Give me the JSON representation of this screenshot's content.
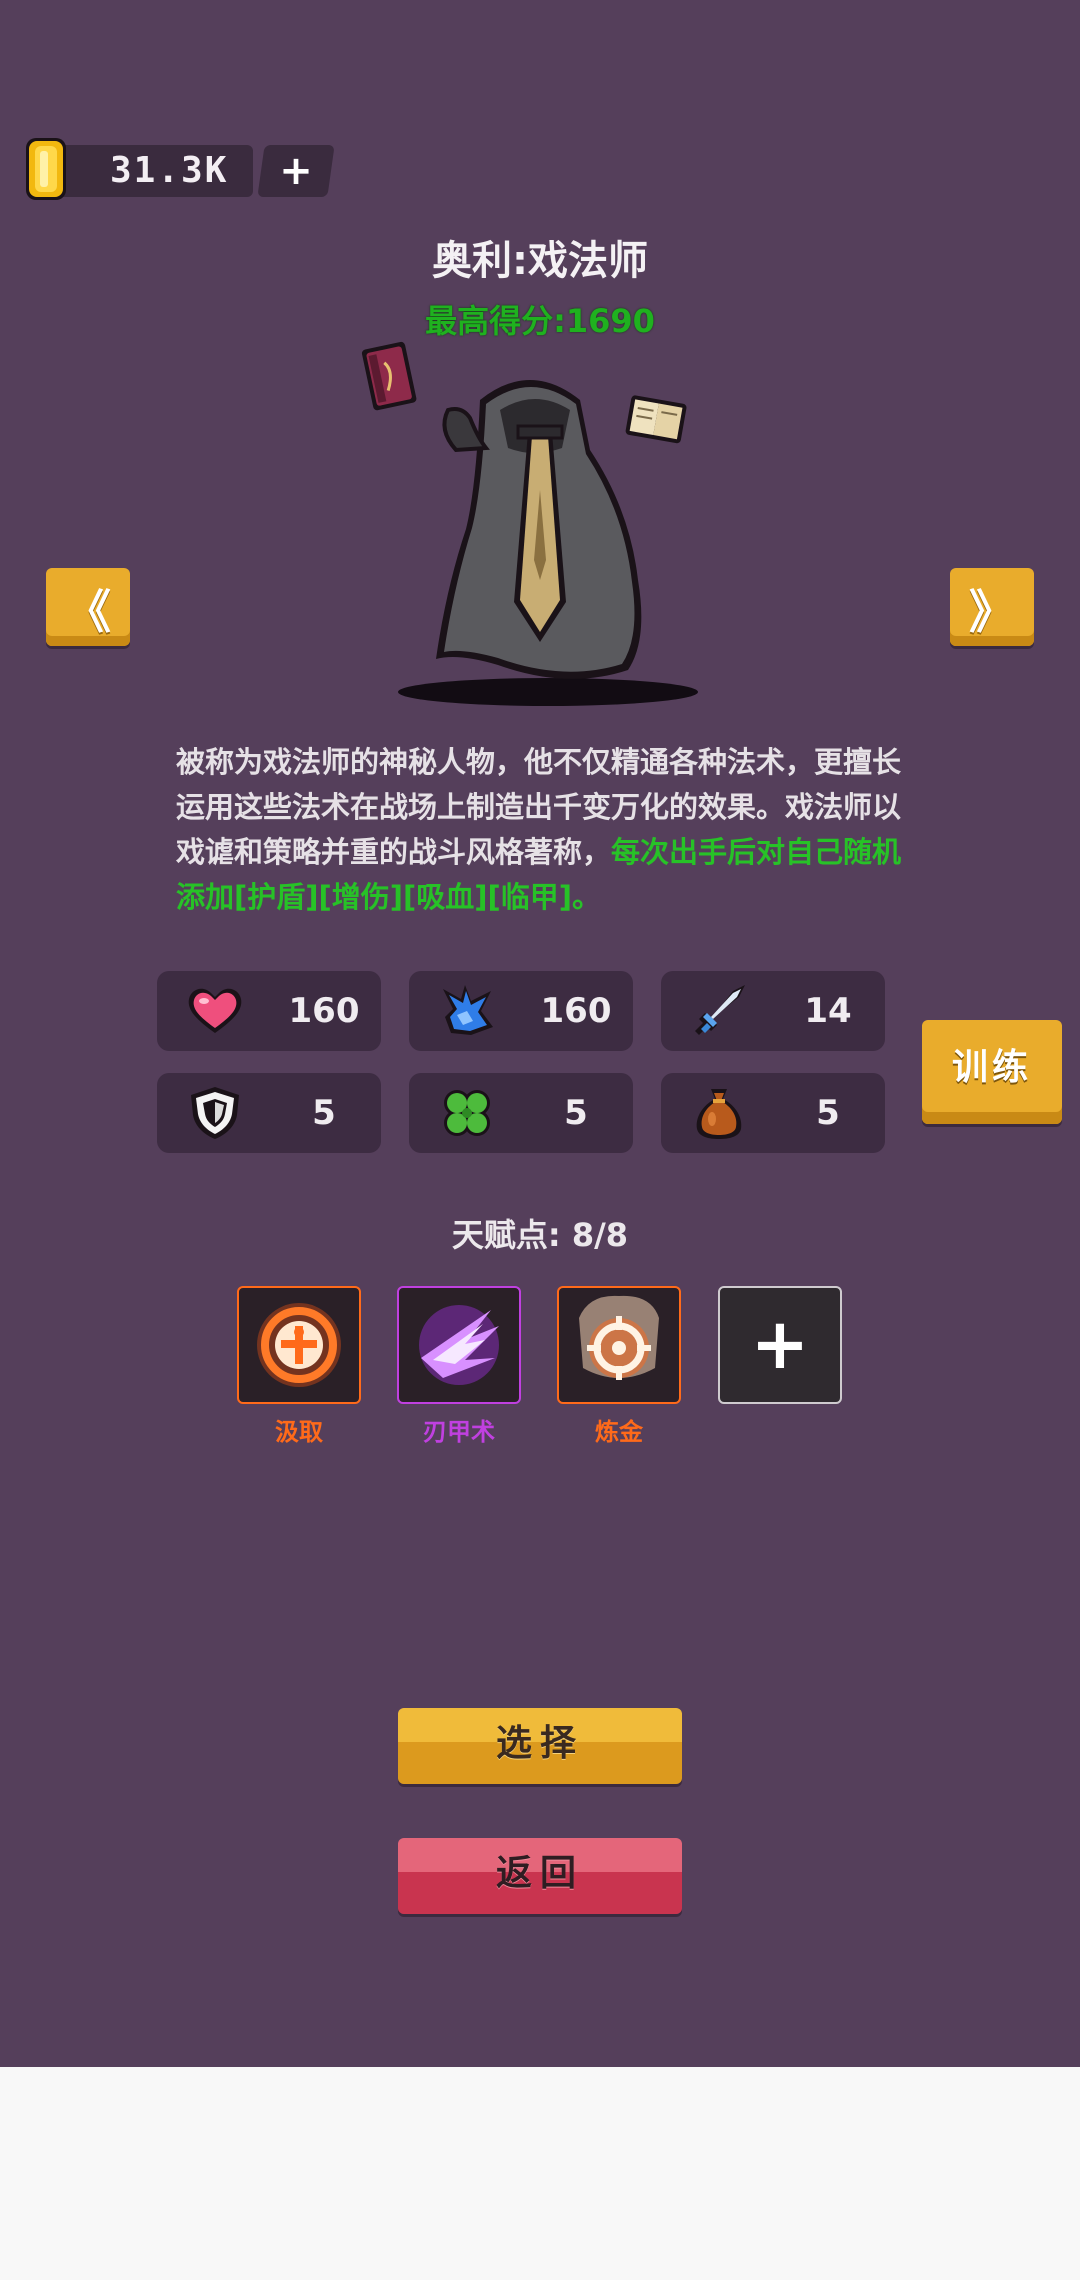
{
  "currency": {
    "amount": "31.3K",
    "add_label": "+"
  },
  "character": {
    "title": "奥利:戏法师",
    "best_score": "最高得分:1690",
    "description_plain": "被称为戏法师的神秘人物，他不仅精通各种法术，更擅长运用这些法术在战场上制造出千变万化的效果。戏法师以戏谑和策略并重的战斗风格著称，",
    "description_highlight": "每次出手后对自己随机添加[护盾][增伤][吸血][临甲]。"
  },
  "nav": {
    "prev_label": "《",
    "next_label": "》"
  },
  "stats": [
    {
      "icon": "heart-icon",
      "value": "160"
    },
    {
      "icon": "mana-splash-icon",
      "value": "160"
    },
    {
      "icon": "sword-icon",
      "value": "14"
    },
    {
      "icon": "shield-icon",
      "value": "5"
    },
    {
      "icon": "clover-icon",
      "value": "5"
    },
    {
      "icon": "money-bag-icon",
      "value": "5"
    }
  ],
  "train_label": "训练",
  "talents": {
    "points_label": "天赋点: 8/8",
    "items": [
      {
        "name": "汲取",
        "color": "#ff6a1a",
        "icon": "drain-icon"
      },
      {
        "name": "刃甲术",
        "color": "#c040e0",
        "icon": "blade-armor-icon"
      },
      {
        "name": "炼金",
        "color": "#ff6a1a",
        "icon": "alchemy-target-icon"
      }
    ],
    "add_label": "+"
  },
  "buttons": {
    "select_label": "选择",
    "back_label": "返回"
  },
  "colors": {
    "background": "#553f5b",
    "accent_gold": "#e9ac2c",
    "highlight_green": "#27c227",
    "back_red": "#c9344f"
  }
}
